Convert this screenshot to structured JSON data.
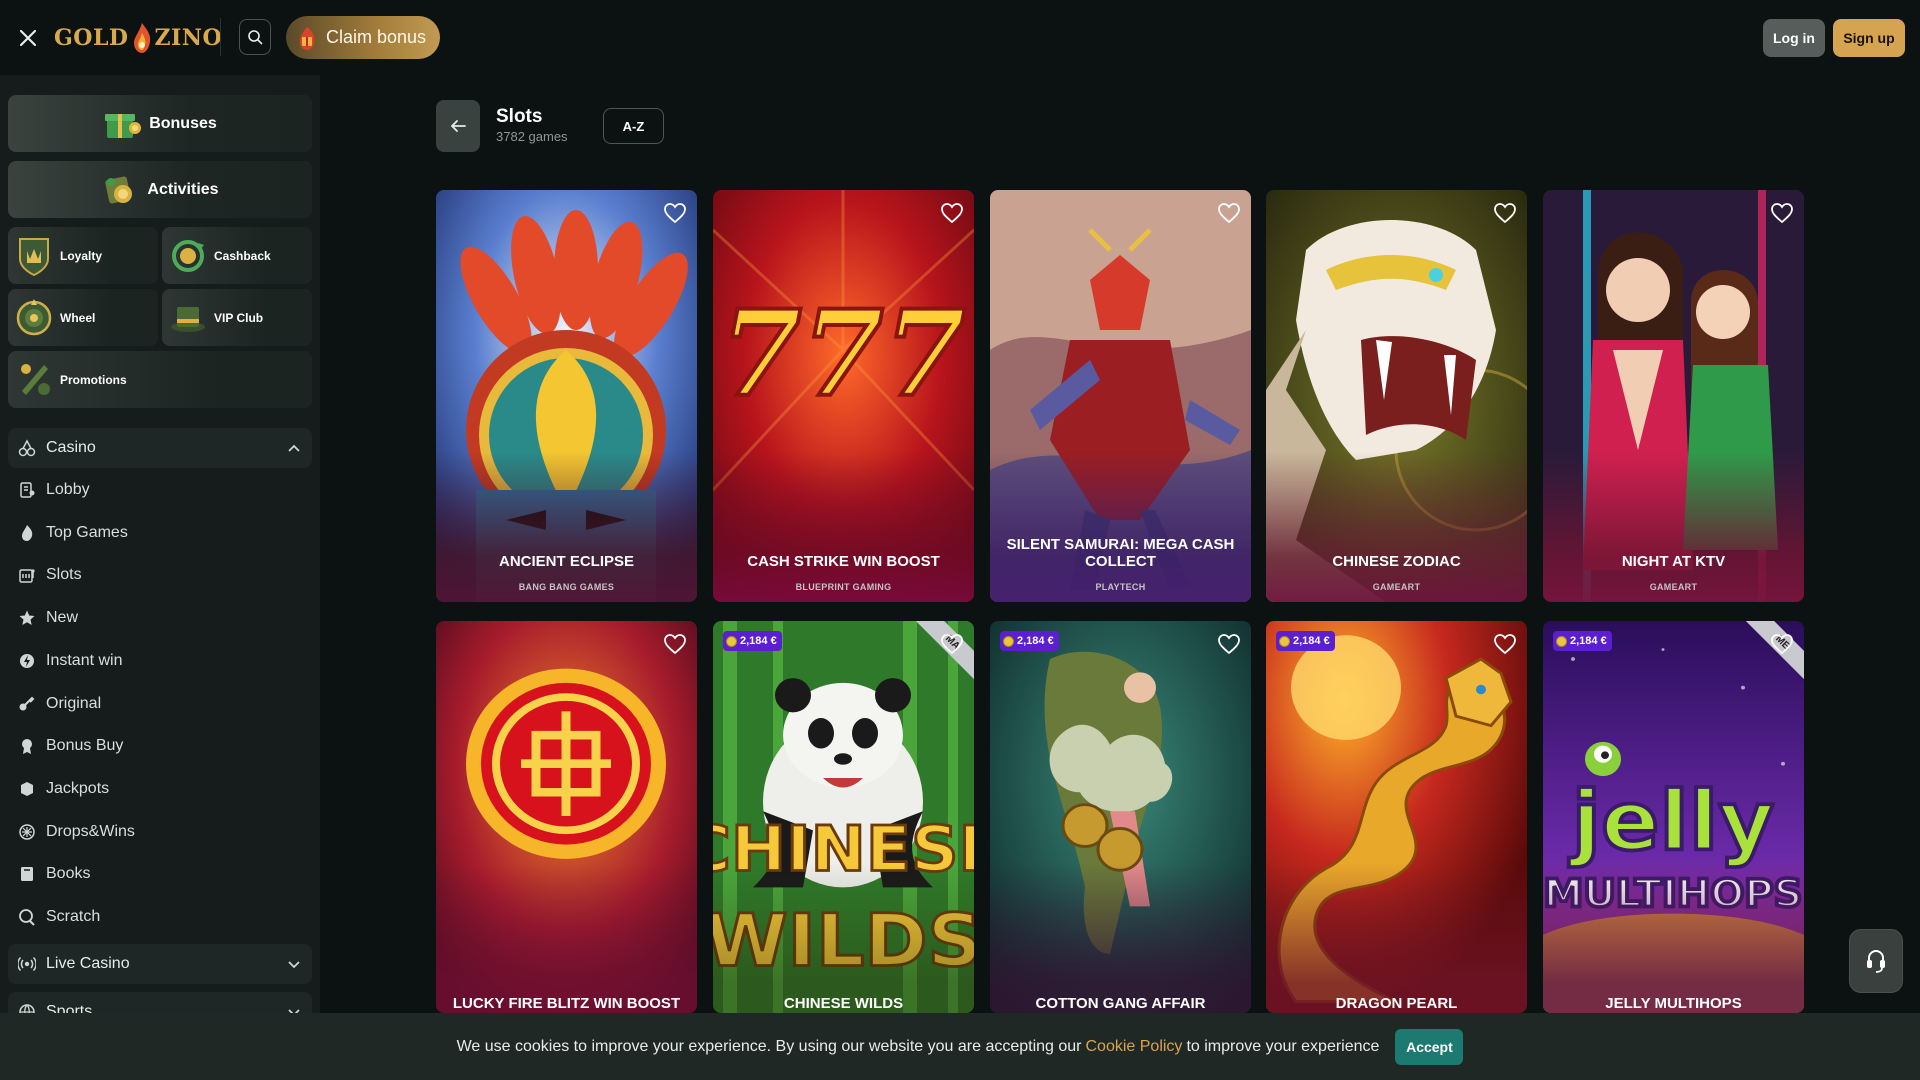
{
  "header": {
    "logo_text_left": "GOLD",
    "logo_text_right": "ZINO",
    "claim_bonus_label": "Claim bonus",
    "login_label": "Log in",
    "signup_label": "Sign up"
  },
  "sidebar": {
    "promos": [
      {
        "label": "Bonuses",
        "icon": "bonuses-icon"
      },
      {
        "label": "Activities",
        "icon": "activities-icon"
      },
      {
        "label": "Loyalty",
        "icon": "loyalty-icon"
      },
      {
        "label": "Cashback",
        "icon": "cashback-icon"
      },
      {
        "label": "Wheel",
        "icon": "wheel-icon"
      },
      {
        "label": "VIP Club",
        "icon": "vip-club-icon"
      },
      {
        "label": "Promotions",
        "icon": "promotions-icon"
      }
    ],
    "casino_label": "Casino",
    "casino_items": [
      {
        "label": "Lobby",
        "icon": "lobby-icon"
      },
      {
        "label": "Top Games",
        "icon": "fire-icon"
      },
      {
        "label": "Slots",
        "icon": "slots-icon"
      },
      {
        "label": "New",
        "icon": "star-icon"
      },
      {
        "label": "Instant win",
        "icon": "instant-win-icon"
      },
      {
        "label": "Original",
        "icon": "original-icon"
      },
      {
        "label": "Bonus Buy",
        "icon": "bonus-buy-icon"
      },
      {
        "label": "Jackpots",
        "icon": "jackpots-icon"
      },
      {
        "label": "Drops&Wins",
        "icon": "drops-wins-icon"
      },
      {
        "label": "Books",
        "icon": "books-icon"
      },
      {
        "label": "Scratch",
        "icon": "scratch-icon"
      }
    ],
    "live_casino_label": "Live Casino",
    "sports_label": "Sports"
  },
  "main": {
    "title": "Slots",
    "count": "3782 games",
    "sort_label": "A-Z"
  },
  "games": [
    {
      "name": "ANCIENT ECLIPSE",
      "provider": "BANG BANG GAMES",
      "jackpot": "",
      "ribbon": ""
    },
    {
      "name": "CASH STRIKE WIN BOOST",
      "provider": "BLUEPRINT GAMING",
      "jackpot": "",
      "ribbon": ""
    },
    {
      "name": "SILENT SAMURAI: MEGA CASH COLLECT",
      "provider": "PLAYTECH",
      "jackpot": "",
      "ribbon": ""
    },
    {
      "name": "CHINESE ZODIAC",
      "provider": "GAMEART",
      "jackpot": "",
      "ribbon": ""
    },
    {
      "name": "NIGHT AT KTV",
      "provider": "GAMEART",
      "jackpot": "",
      "ribbon": ""
    },
    {
      "name": "LUCKY FIRE BLITZ WIN BOOST",
      "provider": "",
      "jackpot": "",
      "ribbon": ""
    },
    {
      "name": "CHINESE WILDS",
      "provider": "",
      "jackpot": "2,184 €",
      "ribbon": "MA"
    },
    {
      "name": "COTTON GANG AFFAIR",
      "provider": "",
      "jackpot": "2,184 €",
      "ribbon": ""
    },
    {
      "name": "DRAGON PEARL",
      "provider": "",
      "jackpot": "2,184 €",
      "ribbon": ""
    },
    {
      "name": "JELLY MULTIHOPS",
      "provider": "",
      "jackpot": "2,184 €",
      "ribbon": "ME"
    }
  ],
  "art_text": {
    "sevens": "777",
    "chinese_wilds_1": "CHINESE",
    "chinese_wilds_2": "WILDS",
    "jelly_1": "jelly",
    "jelly_2": "MULTIHOPS"
  },
  "cookie": {
    "text_before": "We use cookies to improve your experience. By using our website you are accepting our",
    "link": "Cookie Policy",
    "text_after": "to improve your experience",
    "accept_label": "Accept"
  },
  "colors": {
    "background": "#0c1211",
    "sidebar": "#151c1b",
    "accent_gold": "#d6a450",
    "accept_teal": "#1c7a70",
    "jackpot_purple": "#5b1fd1"
  }
}
